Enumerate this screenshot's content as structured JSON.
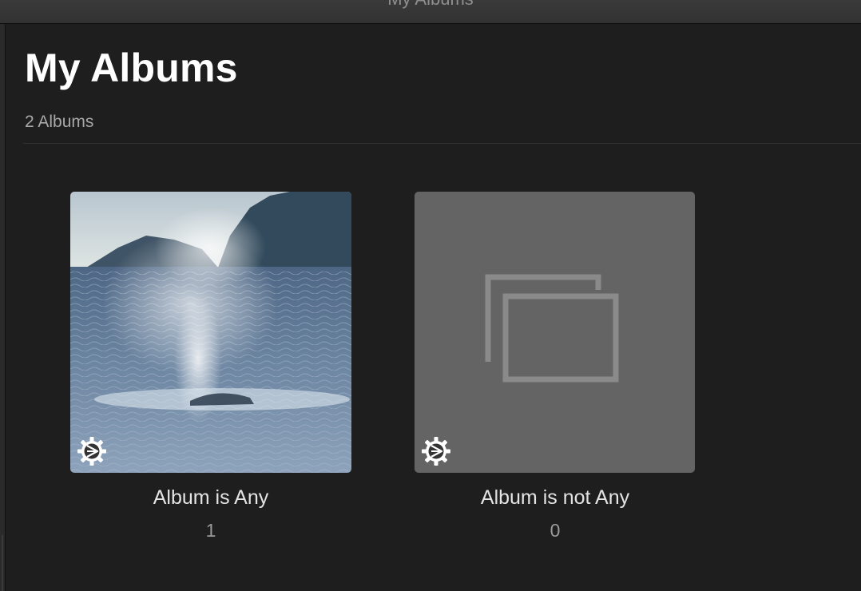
{
  "window": {
    "title": "My Albums"
  },
  "header": {
    "title": "My Albums",
    "subtitle": "2 Albums"
  },
  "albums": [
    {
      "name": "Album is Any",
      "count": "1",
      "thumbnail": "whale-spout-photo",
      "badge_icon": "smart-album-gear-icon"
    },
    {
      "name": "Album is not Any",
      "count": "0",
      "thumbnail": "empty-album-placeholder-icon",
      "badge_icon": "smart-album-gear-icon"
    }
  ],
  "colors": {
    "background": "#1e1e1e",
    "title": "#ffffff",
    "subtitle": "#a8a8a8",
    "placeholder_tile": "#646464",
    "placeholder_icon": "#8a8a8a"
  }
}
